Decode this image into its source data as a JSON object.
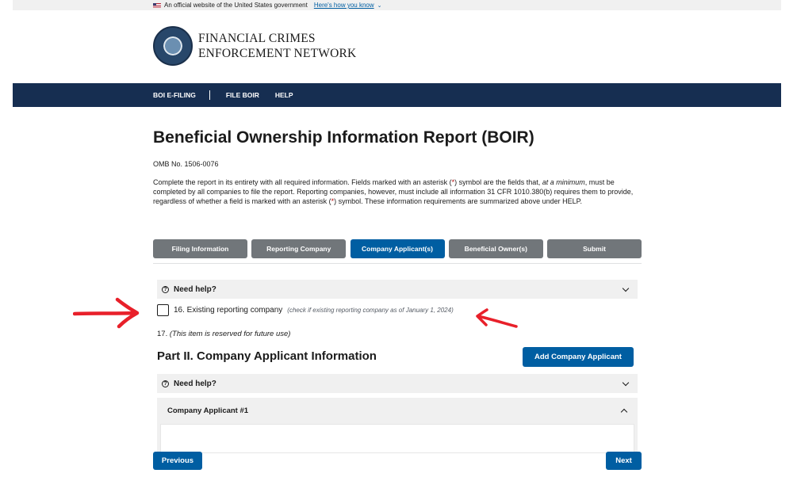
{
  "gov_banner": {
    "text": "An official website of the United States government",
    "link": "Here's how you know"
  },
  "agency": {
    "line1": "FINANCIAL CRIMES",
    "line2": "ENFORCEMENT NETWORK"
  },
  "nav": {
    "items": [
      "BOI E-FILING",
      "FILE BOIR",
      "HELP"
    ]
  },
  "page": {
    "title": "Beneficial Ownership Information Report (BOIR)",
    "omb": "OMB No. 1506-0076",
    "intro_a": "Complete the report in its entirety with all required information. Fields marked with an asterisk (",
    "asterisk": "*",
    "intro_b": ") symbol are the fields that, ",
    "intro_em": "at a minimum",
    "intro_c": ", must be completed by all companies to file the report. Reporting companies, however, must include all information 31 CFR 1010.380(b) requires them to provide, regardless of whether a field is marked with an asterisk (",
    "intro_d": ") symbol. These information requirements are summarized above under HELP."
  },
  "tabs": [
    {
      "label": "Filing Information",
      "active": false
    },
    {
      "label": "Reporting Company",
      "active": false
    },
    {
      "label": "Company Applicant(s)",
      "active": true
    },
    {
      "label": "Beneficial Owner(s)",
      "active": false
    },
    {
      "label": "Submit",
      "active": false
    }
  ],
  "help": {
    "label": "Need help?"
  },
  "existing_company": {
    "label": "16. Existing reporting company",
    "hint": "(check if existing reporting company as of January 1, 2024)",
    "checked": false
  },
  "item17": {
    "number": "17.",
    "text": "(This item is reserved for future use)"
  },
  "part2": {
    "title": "Part II. Company Applicant Information",
    "add_button": "Add Company Applicant"
  },
  "applicant": {
    "label": "Company Applicant #1"
  },
  "footer": {
    "previous": "Previous",
    "next": "Next"
  },
  "colors": {
    "primary": "#005ea2",
    "navbar": "#162e51",
    "inactive_tab": "#71767a",
    "annotation_arrow": "#e8202a"
  }
}
